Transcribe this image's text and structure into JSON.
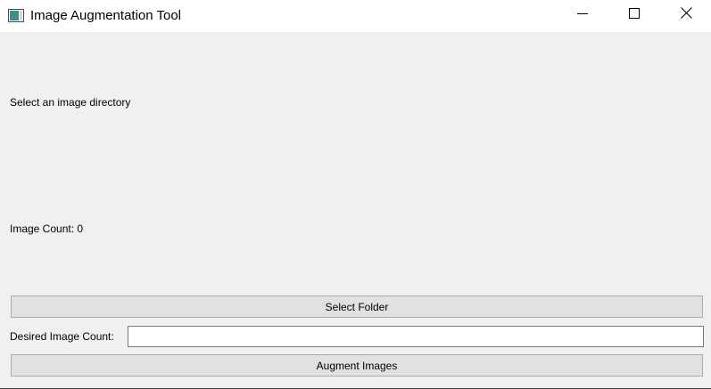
{
  "window": {
    "title": "Image Augmentation Tool",
    "app_icon": "image-app-icon",
    "controls": {
      "minimize_icon": "minimize-icon",
      "maximize_icon": "maximize-icon",
      "close_icon": "close-icon"
    }
  },
  "main": {
    "directory_label": "Select an image directory",
    "image_count_label": "Image Count: 0",
    "select_folder_label": "Select Folder",
    "desired_count_label": "Desired Image Count:",
    "desired_count_value": "",
    "augment_label": "Augment Images"
  },
  "colors": {
    "window_bg": "#f0f0f0",
    "titlebar_bg": "#ffffff",
    "button_bg": "#e1e1e1",
    "button_border": "#adadad"
  }
}
